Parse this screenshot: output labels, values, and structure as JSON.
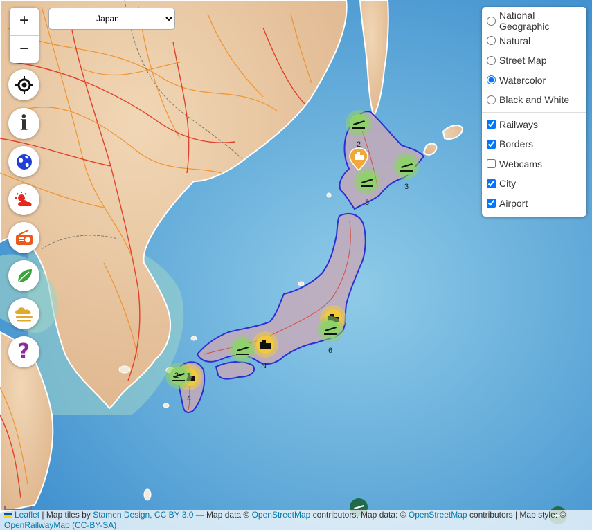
{
  "country_select": {
    "selected": "Japan"
  },
  "zoom": {
    "in_label": "+",
    "out_label": "−"
  },
  "tools": [
    {
      "name": "locate",
      "icon": "crosshair-icon"
    },
    {
      "name": "info",
      "icon": "info-icon",
      "glyph": "i"
    },
    {
      "name": "globe",
      "icon": "globe-icon"
    },
    {
      "name": "weather",
      "icon": "sun-cloud-icon"
    },
    {
      "name": "radio",
      "icon": "radio-icon"
    },
    {
      "name": "nature",
      "icon": "leaf-icon"
    },
    {
      "name": "fog",
      "icon": "fog-icon"
    },
    {
      "name": "help",
      "icon": "question-icon",
      "glyph": "?"
    }
  ],
  "base_layers": [
    {
      "label": "National Geographic",
      "checked": false
    },
    {
      "label": "Natural",
      "checked": false
    },
    {
      "label": "Street Map",
      "checked": false
    },
    {
      "label": "Watercolor",
      "checked": true
    },
    {
      "label": "Black and White",
      "checked": false
    }
  ],
  "overlays": [
    {
      "label": "Railways",
      "checked": true
    },
    {
      "label": "Borders",
      "checked": true
    },
    {
      "label": "Webcams",
      "checked": false
    },
    {
      "label": "City",
      "checked": true
    },
    {
      "label": "Airport",
      "checked": true
    }
  ],
  "clusters": [
    {
      "type": "airport",
      "label": "2"
    },
    {
      "type": "airport",
      "label": "3"
    },
    {
      "type": "airport",
      "label": "8"
    },
    {
      "type": "airport",
      "label": "6"
    },
    {
      "type": "airport",
      "label": ""
    },
    {
      "type": "airport",
      "label": "2"
    },
    {
      "type": "city",
      "label": ""
    },
    {
      "type": "city",
      "label": "N"
    },
    {
      "type": "city",
      "label": "4"
    }
  ],
  "attribution": {
    "leaflet": "Leaflet",
    "sep1": " | Map tiles by ",
    "stamen": "Stamen Design, CC BY 3.0",
    "sep2": " — Map data © ",
    "osm1": "OpenStreetMap",
    "sep3": " contributors, Map data: © ",
    "osm2": "OpenStreetMap",
    "sep4": " contributors | Map style: © ",
    "orm": "OpenRailwayMap",
    "license": "(CC-BY-SA)"
  },
  "colors": {
    "sea": "#6fb4dc",
    "land": "#e9c9a4",
    "railway": "#e0321e",
    "road": "#f08a1c",
    "border_outline": "#2a2fd6",
    "airport_cluster": "#8fd16a",
    "city_cluster": "#f2c93b"
  }
}
